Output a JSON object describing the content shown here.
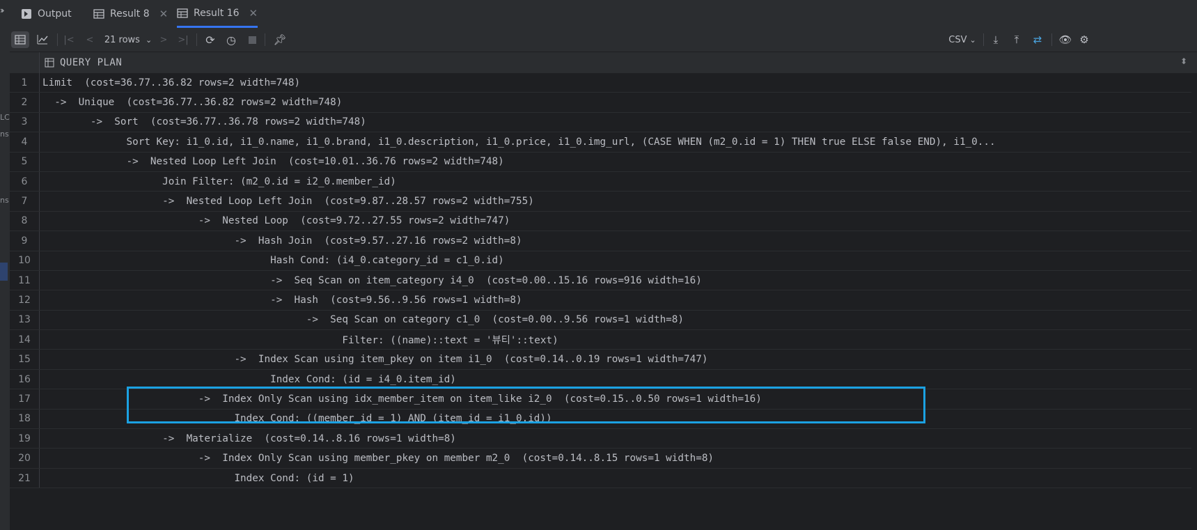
{
  "tabs": [
    {
      "label": "Output",
      "icon": "output-console-icon",
      "active": false,
      "closable": false
    },
    {
      "label": "Result 8",
      "icon": "table-grid-icon",
      "active": false,
      "closable": true
    },
    {
      "label": "Result 16",
      "icon": "table-grid-icon",
      "active": true,
      "closable": true
    }
  ],
  "toolbar": {
    "rows_label": "21 rows",
    "export_format": "CSV"
  },
  "left_strip": {
    "fragments": [
      "LC",
      "ns",
      "ns"
    ]
  },
  "grid": {
    "column_title": "QUERY PLAN",
    "rows": [
      {
        "n": "1",
        "text": "Limit  (cost=36.77..36.82 rows=2 width=748)"
      },
      {
        "n": "2",
        "text": "  ->  Unique  (cost=36.77..36.82 rows=2 width=748)"
      },
      {
        "n": "3",
        "text": "        ->  Sort  (cost=36.77..36.78 rows=2 width=748)"
      },
      {
        "n": "4",
        "text": "              Sort Key: i1_0.id, i1_0.name, i1_0.brand, i1_0.description, i1_0.price, i1_0.img_url, (CASE WHEN (m2_0.id = 1) THEN true ELSE false END), i1_0..."
      },
      {
        "n": "5",
        "text": "              ->  Nested Loop Left Join  (cost=10.01..36.76 rows=2 width=748)"
      },
      {
        "n": "6",
        "text": "                    Join Filter: (m2_0.id = i2_0.member_id)"
      },
      {
        "n": "7",
        "text": "                    ->  Nested Loop Left Join  (cost=9.87..28.57 rows=2 width=755)"
      },
      {
        "n": "8",
        "text": "                          ->  Nested Loop  (cost=9.72..27.55 rows=2 width=747)"
      },
      {
        "n": "9",
        "text": "                                ->  Hash Join  (cost=9.57..27.16 rows=2 width=8)"
      },
      {
        "n": "10",
        "text": "                                      Hash Cond: (i4_0.category_id = c1_0.id)"
      },
      {
        "n": "11",
        "text": "                                      ->  Seq Scan on item_category i4_0  (cost=0.00..15.16 rows=916 width=16)"
      },
      {
        "n": "12",
        "text": "                                      ->  Hash  (cost=9.56..9.56 rows=1 width=8)"
      },
      {
        "n": "13",
        "text": "                                            ->  Seq Scan on category c1_0  (cost=0.00..9.56 rows=1 width=8)"
      },
      {
        "n": "14",
        "text": "                                                  Filter: ((name)::text = '뷰티'::text)"
      },
      {
        "n": "15",
        "text": "                                ->  Index Scan using item_pkey on item i1_0  (cost=0.14..0.19 rows=1 width=747)"
      },
      {
        "n": "16",
        "text": "                                      Index Cond: (id = i4_0.item_id)"
      },
      {
        "n": "17",
        "text": "                          ->  Index Only Scan using idx_member_item on item_like i2_0  (cost=0.15..0.50 rows=1 width=16)"
      },
      {
        "n": "18",
        "text": "                                Index Cond: ((member_id = 1) AND (item_id = i1_0.id))"
      },
      {
        "n": "19",
        "text": "                    ->  Materialize  (cost=0.14..8.16 rows=1 width=8)"
      },
      {
        "n": "20",
        "text": "                          ->  Index Only Scan using member_pkey on member m2_0  (cost=0.14..8.15 rows=1 width=8)"
      },
      {
        "n": "21",
        "text": "                                Index Cond: (id = 1)"
      }
    ]
  },
  "colors": {
    "highlight_border": "#1ba1e2",
    "active_tab_underline": "#3574f0",
    "accent_icon": "#4aa3df"
  }
}
